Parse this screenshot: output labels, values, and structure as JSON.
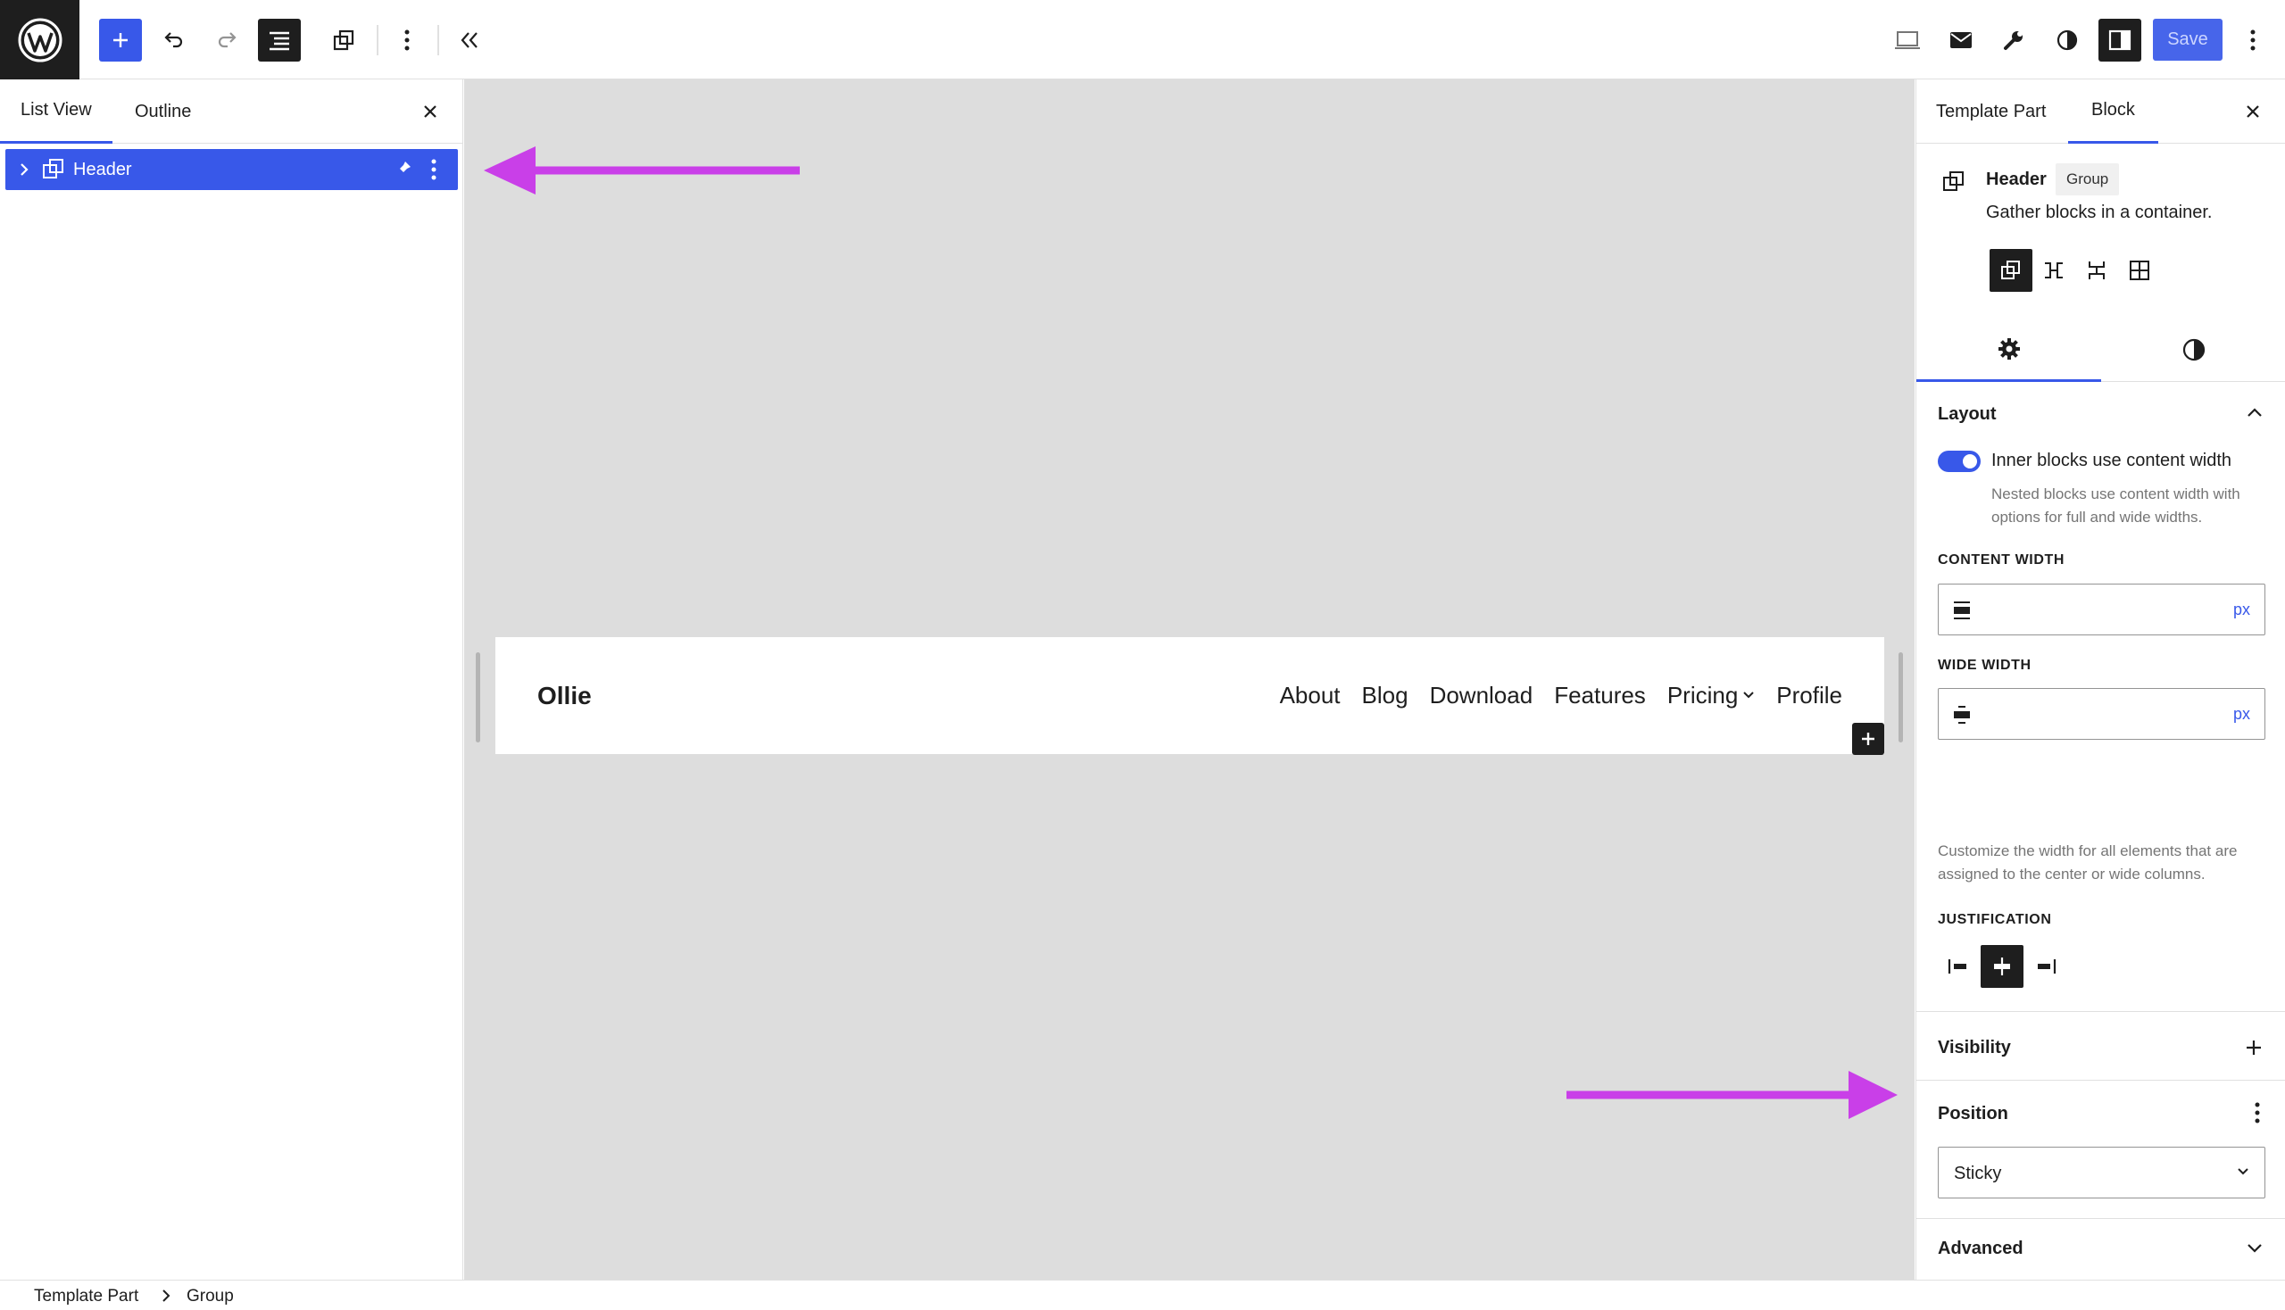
{
  "toolbar": {
    "save_label": "Save"
  },
  "left_panel": {
    "tabs": [
      {
        "label": "List View",
        "active": true
      },
      {
        "label": "Outline",
        "active": false
      }
    ],
    "list_view": {
      "rows": [
        {
          "label": "Header",
          "selected": true
        }
      ]
    }
  },
  "canvas": {
    "site_title": "Ollie",
    "nav_items": [
      "About",
      "Blog",
      "Download",
      "Features",
      "Pricing",
      "Profile"
    ],
    "nav_dropdown_item": "Pricing"
  },
  "right_panel": {
    "tabs": [
      {
        "label": "Template Part",
        "active": false
      },
      {
        "label": "Block",
        "active": true
      }
    ],
    "block_card": {
      "title": "Header",
      "badge": "Group",
      "description": "Gather blocks in a container."
    },
    "layout": {
      "title": "Layout",
      "toggle_label": "Inner blocks use content width",
      "toggle_on": true,
      "toggle_help": "Nested blocks use content width with options for full and wide widths.",
      "content_width_label": "CONTENT WIDTH",
      "content_width_value": "",
      "content_width_unit": "px",
      "wide_width_label": "WIDE WIDTH",
      "wide_width_value": "",
      "wide_width_unit": "px",
      "width_help": "Customize the width for all elements that are assigned to the center or wide columns.",
      "justification_label": "JUSTIFICATION",
      "justification_selected": "center"
    },
    "visibility": {
      "title": "Visibility"
    },
    "position": {
      "title": "Position",
      "value": "Sticky"
    },
    "advanced": {
      "title": "Advanced"
    }
  },
  "breadcrumb": [
    "Template Part",
    "Group"
  ],
  "colors": {
    "accent": "#3858e9",
    "annotation_arrow": "#c93fe8",
    "canvas_bg": "#dddddd",
    "dark": "#1e1e1e"
  }
}
